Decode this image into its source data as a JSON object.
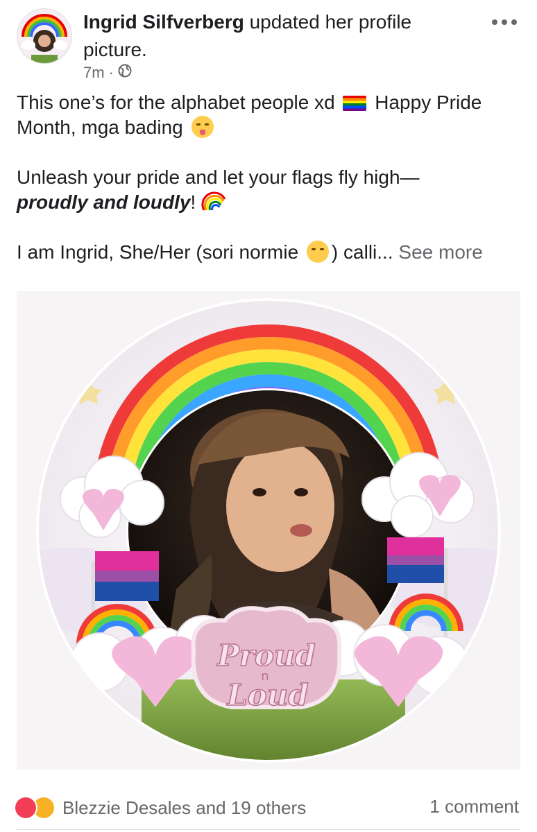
{
  "header": {
    "author_name": "Ingrid Silfverberg",
    "action_text": "updated her profile picture.",
    "time": "7m",
    "privacy_icon": "globe-icon",
    "more_icon": "more-horizontal-icon"
  },
  "post": {
    "line1": "This one’s for the alphabet people xd",
    "line1b": "Happy Pride",
    "line2": "Month, mga bading",
    "line3": "Unleash your pride and let your flags fly high—",
    "line4_bold": "proudly and loudly",
    "line4_suffix": "!",
    "line5": "I am Ingrid, She/Her (sori normie",
    "line5b": ") calli...",
    "see_more": "See more"
  },
  "photo": {
    "sticker_line1": "Proud",
    "sticker_mid": "n",
    "sticker_line2": "Loud"
  },
  "footer": {
    "reaction_icons": [
      "love-reaction-icon",
      "care-reaction-icon"
    ],
    "reaction_text": "Blezzie Desales and 19 others",
    "comments": "1 comment"
  },
  "colors": {
    "text": "#1c1e21",
    "secondary": "#65676b",
    "love": "#f33e58",
    "care": "#f7b125"
  }
}
